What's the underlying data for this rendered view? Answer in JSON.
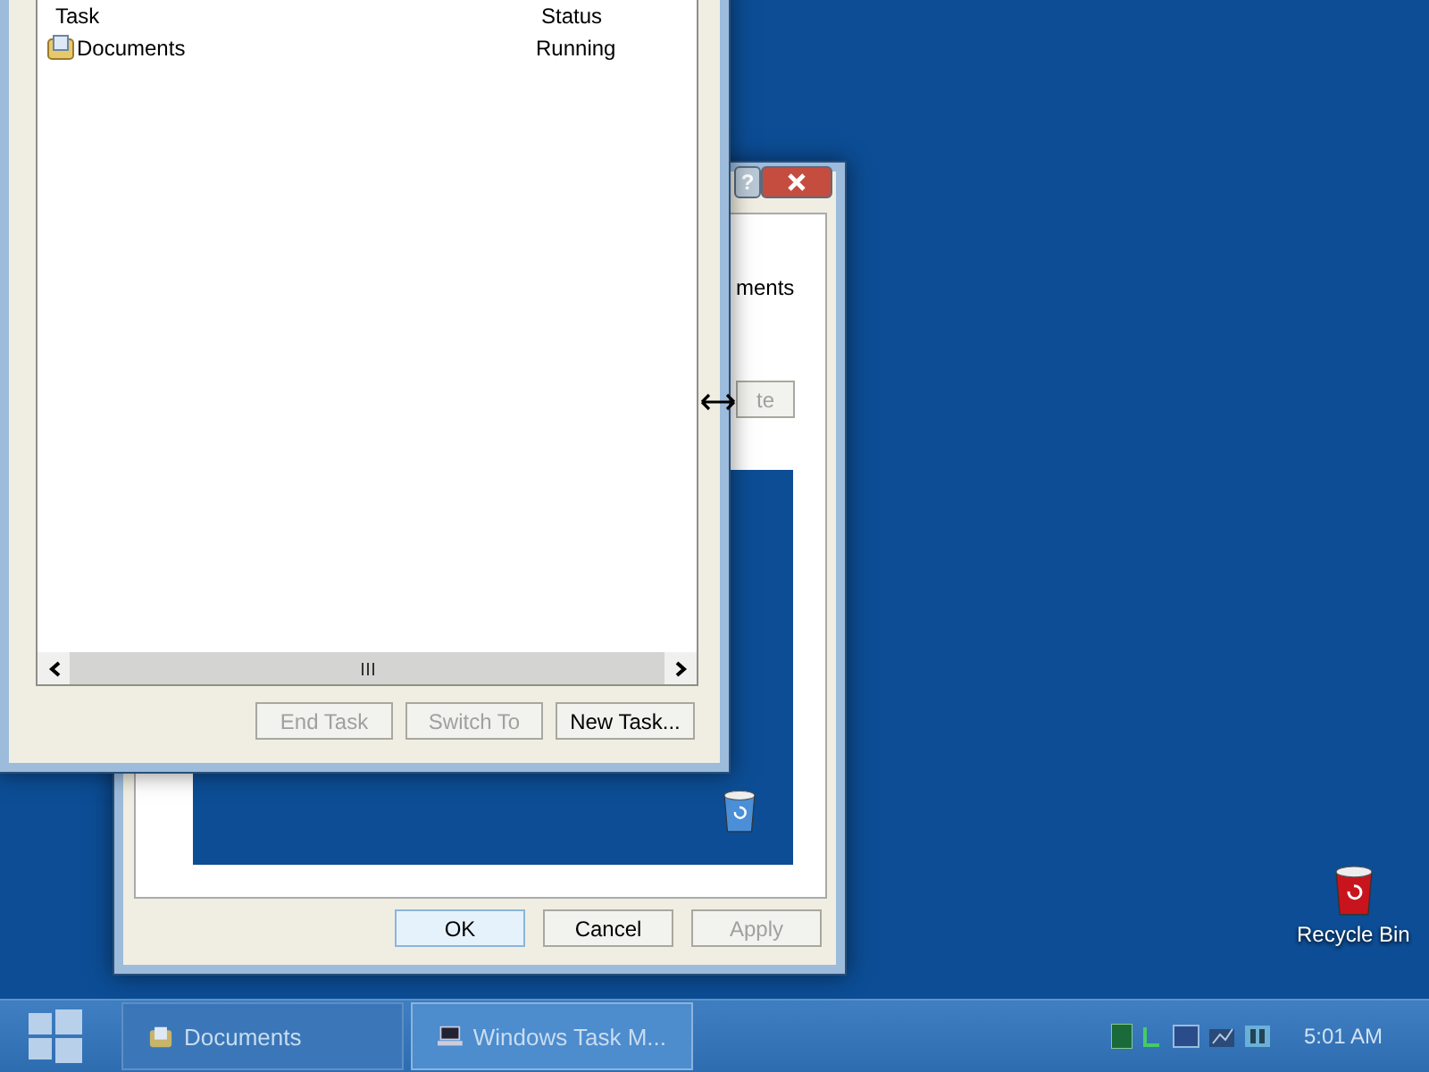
{
  "dialog": {
    "help_label": "?",
    "partial_text": "ments",
    "partial_button": {
      "label": "te",
      "disabled": true
    },
    "buttons": [
      {
        "label": "OK",
        "default": true,
        "disabled": false
      },
      {
        "label": "Cancel",
        "default": false,
        "disabled": false
      },
      {
        "label": "Apply",
        "default": false,
        "disabled": true
      }
    ]
  },
  "task_manager": {
    "columns": [
      "Task",
      "Status"
    ],
    "rows": [
      {
        "task": "Documents",
        "status": "Running"
      }
    ],
    "buttons": [
      {
        "label": "End Task",
        "disabled": true
      },
      {
        "label": "Switch To",
        "disabled": true
      },
      {
        "label": "New Task...",
        "disabled": false
      }
    ]
  },
  "desktop_icons": [
    {
      "label": "Recycle Bin"
    }
  ],
  "taskbar": {
    "items": [
      {
        "label": "Documents",
        "kind": "folder",
        "selected": false
      },
      {
        "label": "Windows Task M...",
        "kind": "computer",
        "selected": true
      }
    ],
    "clock": "5:01 AM"
  }
}
